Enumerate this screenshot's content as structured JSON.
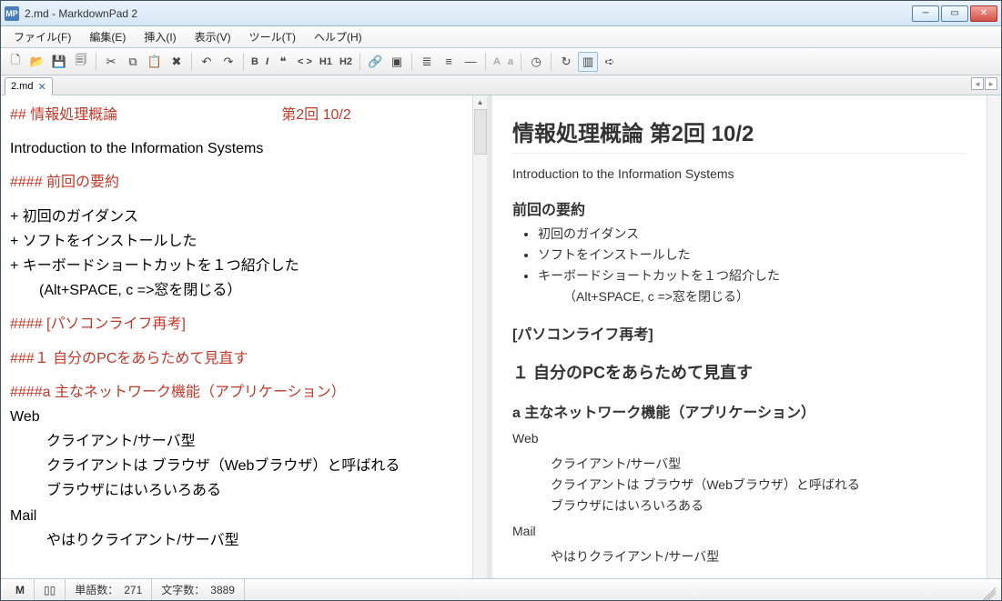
{
  "window": {
    "title": "2.md - MarkdownPad 2",
    "icon_label": "MP"
  },
  "menu": {
    "file": "ファイル(F)",
    "edit": "編集(E)",
    "insert": "挿入(I)",
    "view": "表示(V)",
    "tools": "ツール(T)",
    "help": "ヘルプ(H)"
  },
  "toolbar": {
    "h1": "H1",
    "h2": "H2",
    "quote_mark": "❝",
    "code_mark": "< >",
    "upper_a": "A",
    "lower_a": "a"
  },
  "tab": {
    "label": "2.md"
  },
  "editor": {
    "l1a": "## 情報処理概論",
    "l1b": "第2回 10/2",
    "l2": "Introduction to the Information Systems",
    "l3": "#### 前回の要約",
    "l4": "+ 初回のガイダンス",
    "l5": "+ ソフトをインストールした",
    "l6": "+ キーボードショートカットを１つ紹介した",
    "l7": "  (Alt+SPACE, c  =>窓を閉じる）",
    "l8": "#### [パソコンライフ再考]",
    "l9": "###１ 自分のPCをあらためて見直す",
    "l10": "####a 主なネットワーク機能（アプリケーション）",
    "l11": "Web",
    "l12": "クライアント/サーバ型",
    "l13": "クライアントは ブラウザ（Webブラウザ）と呼ばれる",
    "l14": "ブラウザにはいろいろある",
    "l15": "Mail",
    "l16": "やはりクライアント/サーバ型"
  },
  "preview": {
    "h2": "情報処理概論 第2回 10/2",
    "p1": "Introduction to the Information Systems",
    "h4a": "前回の要約",
    "li1": "初回のガイダンス",
    "li2": "ソフトをインストールした",
    "li3": "キーボードショートカットを１つ紹介した",
    "li3b": "（Alt+SPACE, c =>窓を閉じる）",
    "h4b": "[パソコンライフ再考]",
    "h3": "１ 自分のPCをあらためて見直す",
    "h4c": "a 主なネットワーク機能（アプリケーション）",
    "web": "Web",
    "web1": "クライアント/サーバ型",
    "web2": "クライアントは ブラウザ（Webブラウザ）と呼ばれる",
    "web3": "ブラウザにはいろいろある",
    "mail": "Mail",
    "mail1": "やはりクライアント/サーバ型"
  },
  "status": {
    "words_label": "単語数：",
    "words": "271",
    "chars_label": "文字数：",
    "chars": "3889"
  }
}
